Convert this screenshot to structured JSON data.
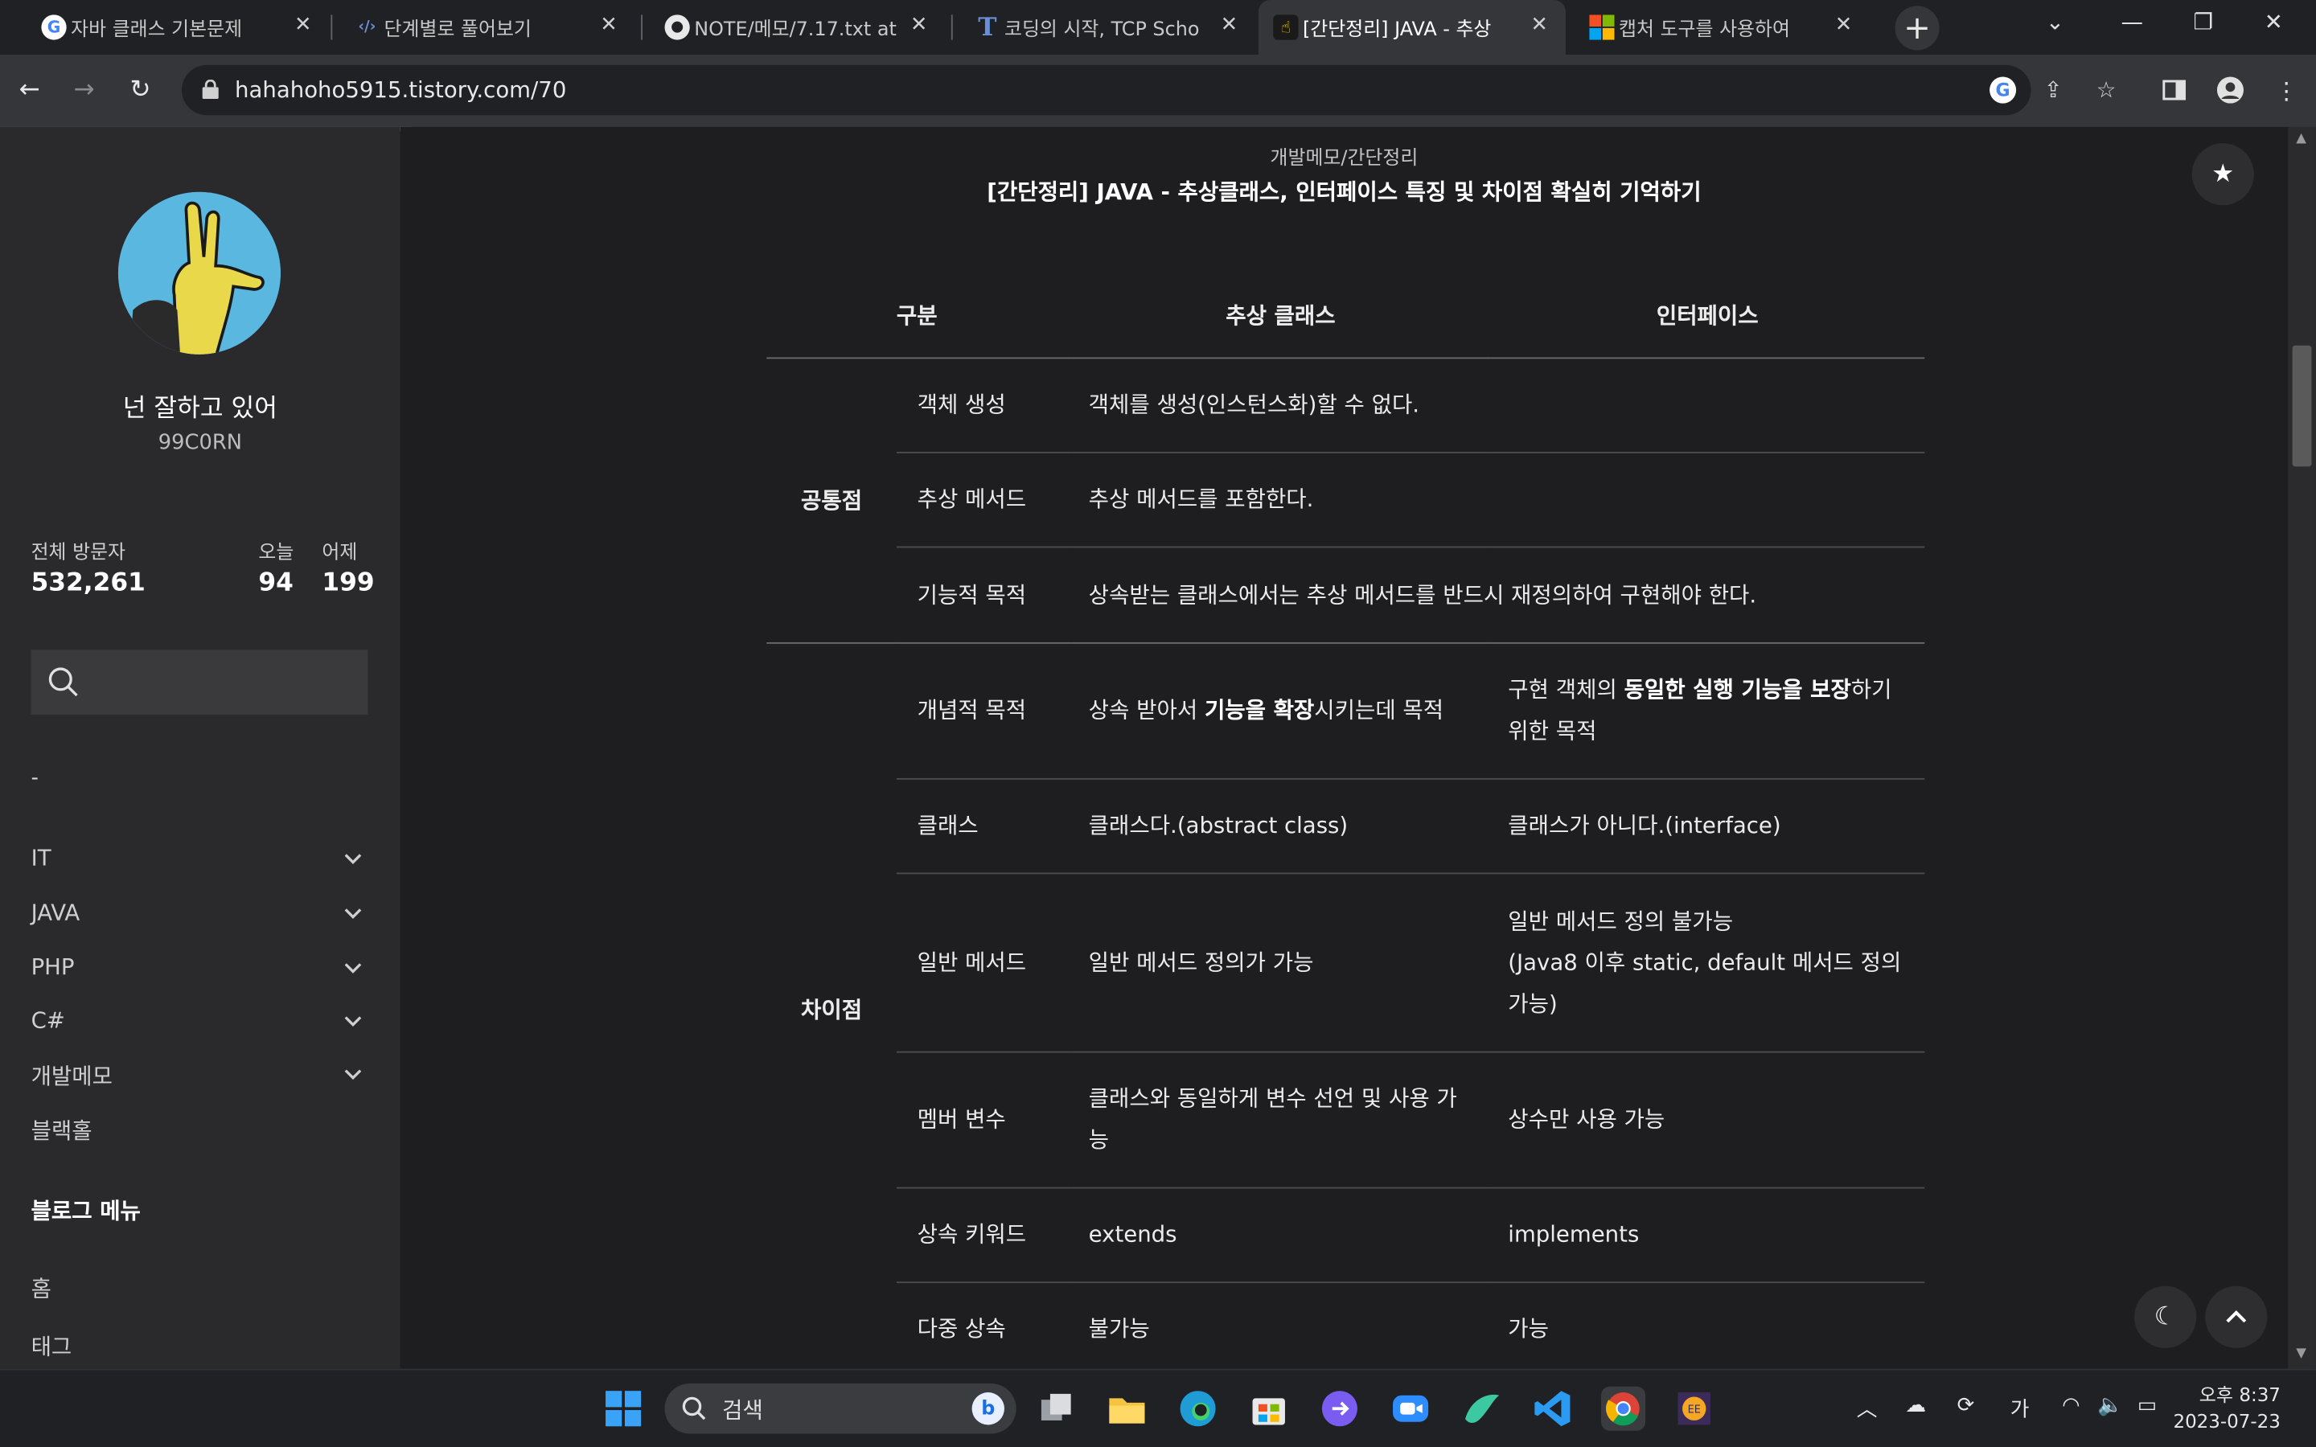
{
  "browser": {
    "tabs": [
      {
        "title": "자바 클래스 기본문제",
        "icon": "google-icon"
      },
      {
        "title": "단계별로 풀어보기",
        "icon": "code-icon"
      },
      {
        "title": "NOTE/메모/7.17.txt at",
        "icon": "github-icon"
      },
      {
        "title": "코딩의 시작, TCP Scho",
        "icon": "tcpschool-icon"
      },
      {
        "title": "[간단정리] JAVA - 추상",
        "icon": "tistory-icon"
      },
      {
        "title": "캡처 도구를 사용하여",
        "icon": "microsoft-icon"
      }
    ],
    "url": "hahahoho5915.tistory.com/70"
  },
  "sidebar": {
    "blog_title": "넌 잘하고 있어",
    "blog_subtitle": "99C0RN",
    "stats": {
      "total_label": "전체 방문자",
      "total_value": "532,261",
      "today_label": "오늘",
      "today_value": "94",
      "yesterday_label": "어제",
      "yesterday_value": "199"
    },
    "dash": "-",
    "categories": [
      "IT",
      "JAVA",
      "PHP",
      "C#",
      "개발메모",
      "블랙홀"
    ],
    "menu_title": "블로그 메뉴",
    "menu_items": [
      "홈",
      "태그"
    ]
  },
  "post": {
    "breadcrumb": "개발메모/간단정리",
    "title": "[간단정리] JAVA - 추상클래스, 인터페이스 특징 및 차이점 확실히 기억하기",
    "table": {
      "headers": [
        "구분",
        "추상 클래스",
        "인터페이스"
      ],
      "groups": [
        "공통점",
        "차이점"
      ],
      "common_rows": [
        {
          "name": "객체 생성",
          "value": "객체를 생성(인스턴스화)할 수 없다."
        },
        {
          "name": "추상 메서드",
          "value": "추상 메서드를 포함한다."
        },
        {
          "name": "기능적 목적",
          "value": "상속받는 클래스에서는 추상 메서드를 반드시 재정의하여 구현해야 한다."
        }
      ],
      "diff_rows": [
        {
          "name": "개념적 목적",
          "abstract_pre": "상속 받아서 ",
          "abstract_bold": "기능을 확장",
          "abstract_post": "시키는데 목적",
          "iface_pre": "구현 객체의 ",
          "iface_bold": "동일한 실행 기능을 보장",
          "iface_post": "하기 위한 목적"
        },
        {
          "name": "클래스",
          "abstract": "클래스다.(abstract class)",
          "iface": "클래스가 아니다.(interface)"
        },
        {
          "name": "일반 메서드",
          "abstract": "일반 메서드 정의가 가능",
          "iface_line1": "일반 메서드 정의 불가능",
          "iface_line2": "(Java8 이후 static, default 메서드 정의 가능)"
        },
        {
          "name": "멤버 변수",
          "abstract": "클래스와 동일하게 변수 선언 및 사용 가능",
          "iface": "상수만 사용 가능"
        },
        {
          "name": "상속 키워드",
          "abstract": "extends",
          "iface": "implements"
        },
        {
          "name": "다중 상속",
          "abstract": "불가능",
          "iface": "가능"
        }
      ]
    }
  },
  "taskbar": {
    "search_label": "검색",
    "ime": "가",
    "time": "오후 8:37",
    "date": "2023-07-23"
  },
  "colors": {
    "page_bg": "#1e1e20",
    "sidebar_bg": "#2a2a2c",
    "chrome_tab_bg": "#202124",
    "chrome_toolbar_bg": "#35363a"
  }
}
